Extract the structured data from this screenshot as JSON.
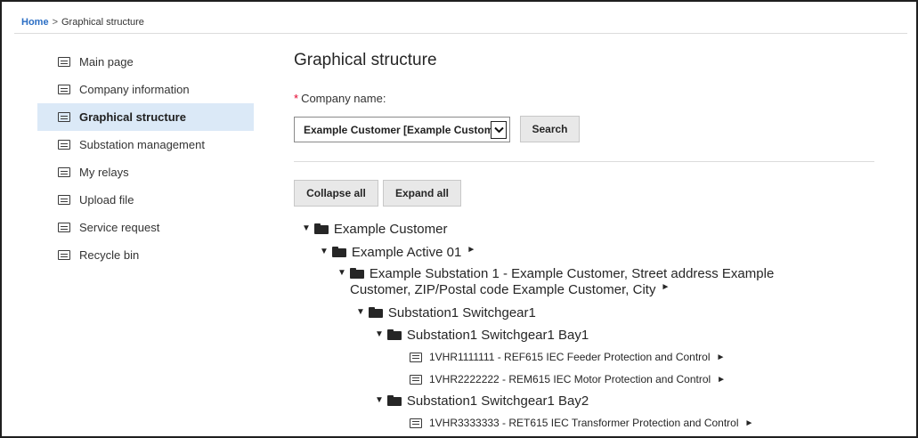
{
  "breadcrumb": {
    "home": "Home",
    "separator": ">",
    "current": "Graphical structure"
  },
  "sidebar": {
    "items": [
      {
        "label": "Main page"
      },
      {
        "label": "Company information"
      },
      {
        "label": "Graphical structure"
      },
      {
        "label": "Substation management"
      },
      {
        "label": "My relays"
      },
      {
        "label": "Upload file"
      },
      {
        "label": "Service request"
      },
      {
        "label": "Recycle bin"
      }
    ],
    "active_index": 2
  },
  "main": {
    "title": "Graphical structure",
    "required_marker": "*",
    "company_label": "Company name:",
    "company_value": "Example Customer [Example Customer]",
    "search_label": "Search",
    "collapse_label": "Collapse all",
    "expand_label": "Expand all"
  },
  "tree": {
    "toggle_glyph": "▼",
    "open_glyph": "►",
    "customer": "Example Customer",
    "active": "Example Active 01",
    "substation_line1": "Example Substation 1 - Example Customer, Street address Example",
    "substation_line2": "Customer, ZIP/Postal code Example Customer, City",
    "switchgear": "Substation1 Switchgear1",
    "bay1": "Substation1 Switchgear1 Bay1",
    "relay1": "1VHR1111111 - REF615 IEC Feeder Protection and Control",
    "relay2": "1VHR2222222 - REM615 IEC Motor Protection and Control",
    "bay2": "Substation1 Switchgear1 Bay2",
    "relay3": "1VHR3333333 - RET615 IEC Transformer Protection and Control"
  },
  "icons": [
    "document-icon",
    "folder-icon",
    "expand-toggle-icon",
    "open-arrow-icon",
    "dropdown-arrow-icon"
  ],
  "colors": {
    "link": "#2b6ec4",
    "active_bg": "#dbe9f7",
    "required": "#e4002b",
    "button_bg": "#e8e8e8"
  }
}
